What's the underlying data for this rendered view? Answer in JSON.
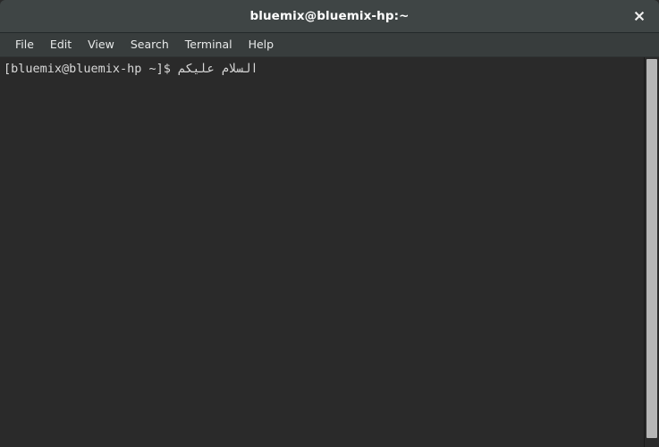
{
  "window": {
    "title": "bluemix@bluemix-hp:~",
    "close_icon": "close-icon",
    "background_color": "#2a2a2a",
    "titlebar_color": "#3f4545",
    "menubar_color": "#383d3d"
  },
  "menubar": {
    "items": [
      {
        "label": "File"
      },
      {
        "label": "Edit"
      },
      {
        "label": "View"
      },
      {
        "label": "Search"
      },
      {
        "label": "Terminal"
      },
      {
        "label": "Help"
      }
    ]
  },
  "terminal": {
    "text_color": "#d8d8d8",
    "lines": [
      {
        "prompt": "[bluemix@bluemix-hp ~]$ ",
        "command": "السلام عليكم"
      }
    ]
  },
  "scrollbar": {
    "thumb_color": "#b6b6b6",
    "track_color": "#2a2a2a"
  }
}
